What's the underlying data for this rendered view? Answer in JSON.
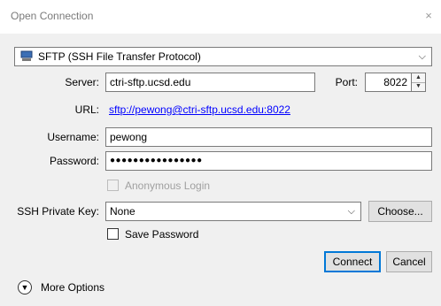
{
  "window": {
    "title": "Open Connection",
    "close_glyph": "×"
  },
  "protocol": {
    "selected": "SFTP (SSH File Transfer Protocol)",
    "icon": "network-drive-icon",
    "chevron": "⌵"
  },
  "server": {
    "label": "Server:",
    "value": "ctri-sftp.ucsd.edu"
  },
  "port": {
    "label": "Port:",
    "value": "8022",
    "up": "▲",
    "down": "▼"
  },
  "url": {
    "label": "URL:",
    "value": "sftp://pewong@ctri-sftp.ucsd.edu:8022"
  },
  "username": {
    "label": "Username:",
    "value": "pewong"
  },
  "password": {
    "label": "Password:",
    "masked_value": "●●●●●●●●●●●●●●●●"
  },
  "anonymous_login": {
    "label": "Anonymous Login",
    "checked": false,
    "enabled": false
  },
  "ssh_key": {
    "label": "SSH Private Key:",
    "selected": "None",
    "chevron": "⌵",
    "choose_label": "Choose..."
  },
  "save_password": {
    "label": "Save Password",
    "checked": false
  },
  "buttons": {
    "connect": "Connect",
    "cancel": "Cancel"
  },
  "more_options": {
    "label": "More Options",
    "icon_glyph": "▼"
  },
  "colors": {
    "accent": "#0078d7",
    "link": "#0000ff",
    "dialog_bg": "#f0f0f0"
  }
}
